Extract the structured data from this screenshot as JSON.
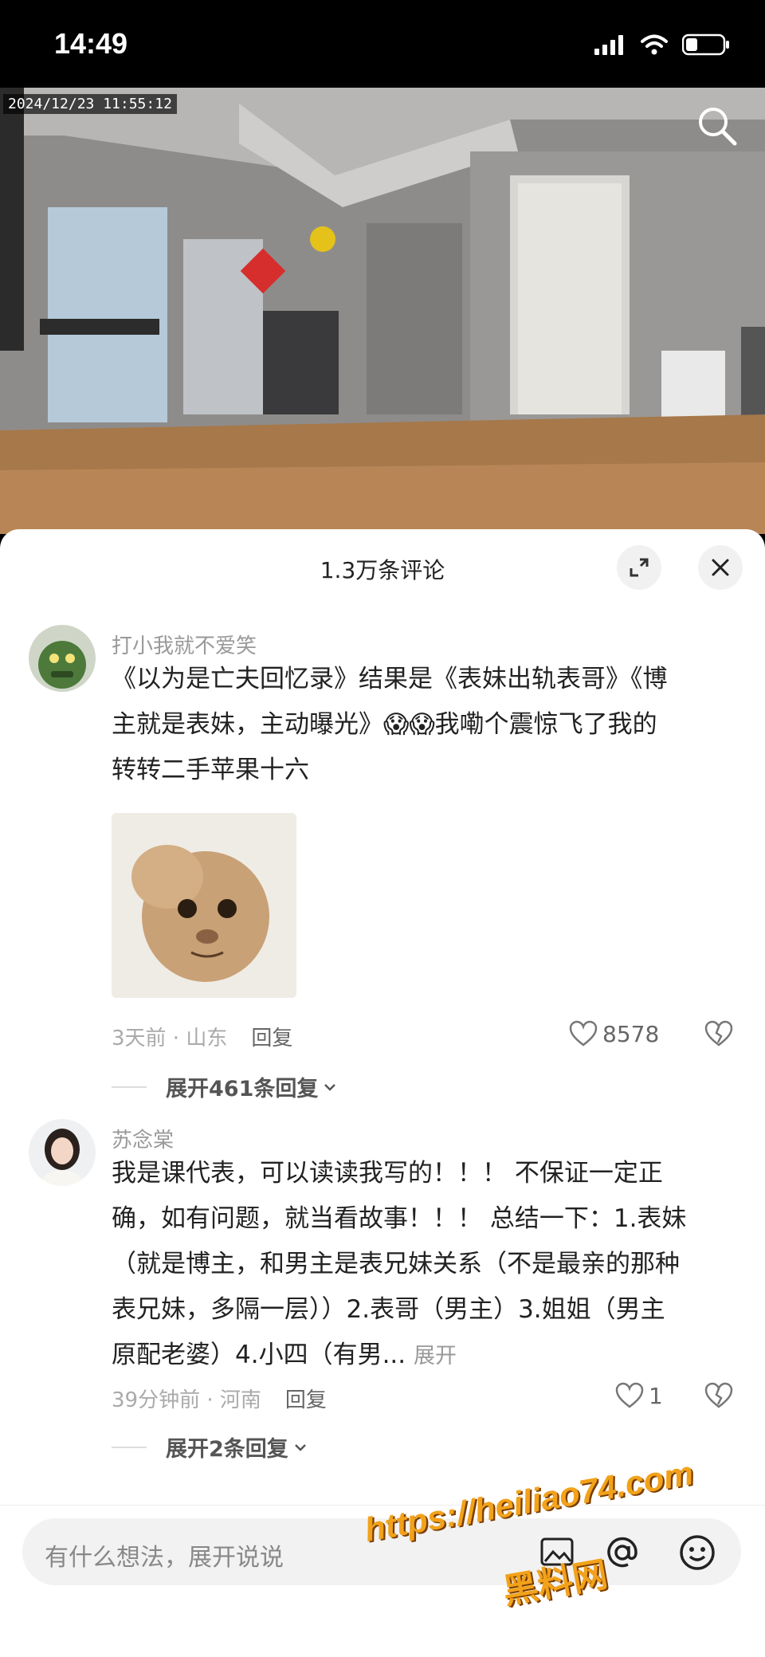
{
  "status_bar": {
    "time": "14:49"
  },
  "video": {
    "timestamp": "2024/12/23 11:55:12"
  },
  "sheet": {
    "title": "1.3万条评论"
  },
  "comments": [
    {
      "username": "打小我就不爱笑",
      "text_lines": [
        "《以为是亡夫回忆录》结果是《表妹出轨表哥》《博",
        "主就是表妹，主动曝光》😱😱我嘞个震惊飞了我的",
        "转转二手苹果十六"
      ],
      "time_location": "3天前 · 山东",
      "reply_label": "回复",
      "likes": "8578",
      "expand_label": "展开461条回复"
    },
    {
      "username": "苏念棠",
      "text_lines": [
        "我是课代表，可以读读我写的！！！ 不保证一定正",
        "确，如有问题，就当看故事！！！ 总结一下：1.表妹",
        "（就是博主，和男主是表兄妹关系（不是最亲的那种",
        "表兄妹，多隔一层））2.表哥（男主）3.姐姐（男主",
        "原配老婆）4.小四（有男..."
      ],
      "more_label": "展开",
      "time_location": "39分钟前 · 河南",
      "reply_label": "回复",
      "likes": "1",
      "expand_label": "展开2条回复"
    }
  ],
  "input": {
    "placeholder": "有什么想法，展开说说"
  },
  "watermark": {
    "line1": "https://heiliao74.com",
    "line2": "黑料网"
  }
}
